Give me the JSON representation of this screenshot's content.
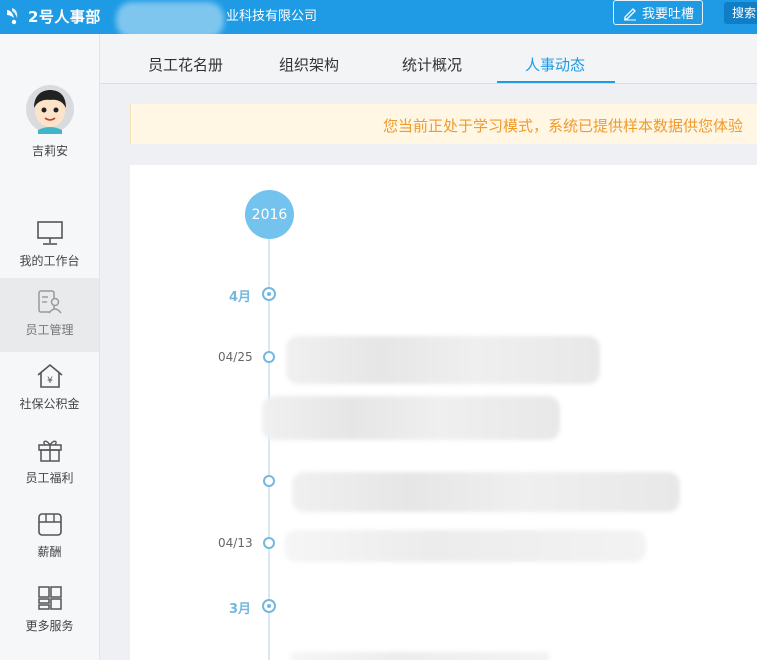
{
  "header": {
    "logo_text": "2号人事部",
    "company_name": "业科技有限公司",
    "feedback_label": "我要吐槽",
    "search_label": "搜索"
  },
  "user": {
    "name": "吉莉安"
  },
  "sidebar": {
    "items": [
      {
        "label": "我的工作台",
        "icon": "monitor-icon"
      },
      {
        "label": "员工管理",
        "icon": "employee-icon"
      },
      {
        "label": "社保公积金",
        "icon": "social-insurance-icon"
      },
      {
        "label": "员工福利",
        "icon": "gift-icon"
      },
      {
        "label": "薪酬",
        "icon": "salary-icon"
      },
      {
        "label": "更多服务",
        "icon": "more-services-icon"
      }
    ]
  },
  "tabs": [
    {
      "label": "员工花名册"
    },
    {
      "label": "组织架构"
    },
    {
      "label": "统计概况"
    },
    {
      "label": "人事动态",
      "active": true
    }
  ],
  "notice": {
    "text": "您当前正处于学习模式，系统已提供样本数据供您体验"
  },
  "timeline": {
    "year": "2016",
    "months": [
      {
        "label": "4月"
      },
      {
        "label": "3月"
      }
    ],
    "dates": [
      "04/25",
      "04/13"
    ]
  },
  "colors": {
    "primary": "#1e9be4",
    "timeline": "#74b8e0",
    "notice_text": "#ef9b2f",
    "notice_bg": "#fff7e3"
  }
}
